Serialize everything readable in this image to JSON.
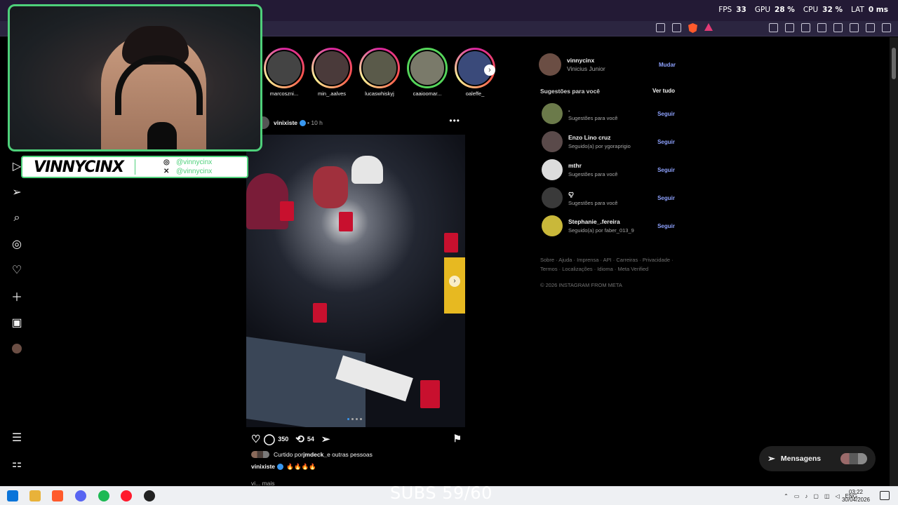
{
  "hud": {
    "fps_label": "FPS",
    "fps": "33",
    "gpu_label": "GPU",
    "gpu": "28 %",
    "cpu_label": "CPU",
    "cpu": "32 %",
    "lat_label": "LAT",
    "lat": "0 ms"
  },
  "overlay": {
    "streamer_name": "VINNYCINX",
    "instagram": "@vinnycinx",
    "x": "@vinnycinx",
    "subs": "SUBS 59/60"
  },
  "stories": [
    {
      "label": "marcoszni...",
      "seen": false
    },
    {
      "label": "min_.aalves",
      "seen": false
    },
    {
      "label": "lucaswhiskyj",
      "seen": false
    },
    {
      "label": "caaioomar...",
      "seen": true
    },
    {
      "label": "oaleffe_",
      "seen": false
    }
  ],
  "post": {
    "user": "vinixiste",
    "time": "• 10 h",
    "more": "•••",
    "likes_count": "350",
    "comments_count": "54",
    "liked_by_prefix": "Curtido por ",
    "liked_by_user": "jmdeck_",
    "liked_by_suffix": " e outras pessoas",
    "caption_user": "vinixiste",
    "caption_text": "🔥🔥🔥🔥",
    "more_line": "vi... mais"
  },
  "profile": {
    "username": "vinnycinx",
    "name": "Vinicius Junior",
    "switch": "Mudar"
  },
  "suggestions_header": {
    "title": "Sugestões para você",
    "see_all": "Ver tudo"
  },
  "suggestions": [
    {
      "user": ".",
      "sub": "Sugestões para você",
      "follow": "Seguir"
    },
    {
      "user": "Enzo Lino cruz",
      "sub": "Seguido(a) por ygoraprigio",
      "follow": "Seguir"
    },
    {
      "user": "mthr",
      "sub": "Sugestões para você",
      "follow": "Seguir"
    },
    {
      "user": "ꨄ",
      "sub": "Sugestões para você",
      "follow": "Seguir"
    },
    {
      "user": "Stephanie_.fereira",
      "sub": "Seguido(a) por faber_013_9",
      "follow": "Seguir"
    }
  ],
  "footer": {
    "links": "Sobre · Ajuda · Imprensa · API · Carreiras · Privacidade · Termos · Localizações · Idioma · Meta Verified",
    "copyright": "© 2026 INSTAGRAM FROM META"
  },
  "messages": {
    "label": "Mensagens"
  },
  "taskbar": {
    "lang": "ENG",
    "time": "03:22",
    "date": "30/04/2026"
  },
  "colors": {
    "accent_link": "#8ea2ff",
    "webcam_border": "#4ed07a",
    "browser_bar": "#231a35"
  }
}
